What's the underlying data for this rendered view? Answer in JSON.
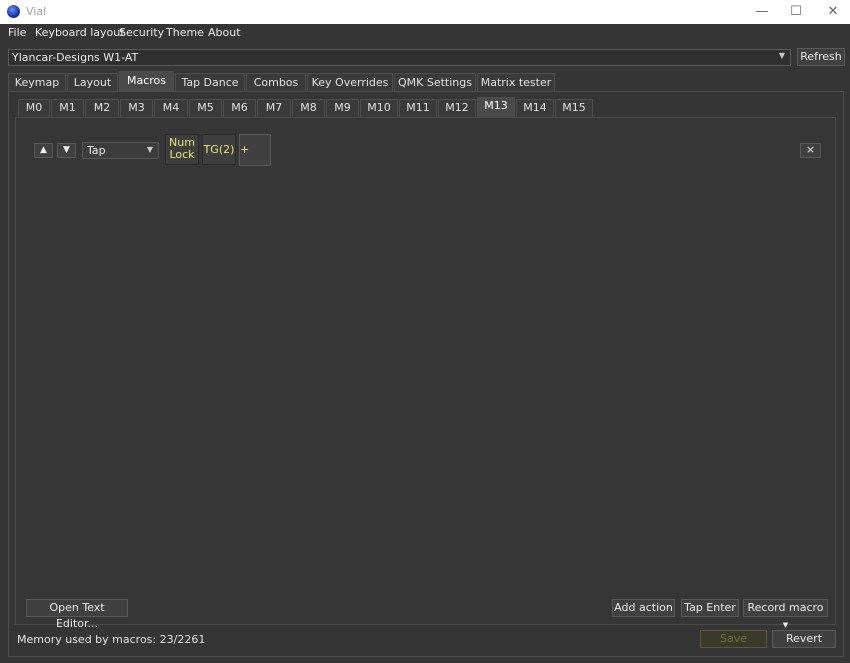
{
  "window": {
    "title": "Vial",
    "minimize_glyph": "—",
    "maximize_glyph": "☐",
    "close_glyph": "✕"
  },
  "menu": [
    "File",
    "Keyboard layout",
    "Security",
    "Theme",
    "About"
  ],
  "device": {
    "selected": "Ylancar-Designs W1-AT",
    "refresh_label": "Refresh"
  },
  "tabs": [
    "Keymap",
    "Layout",
    "Macros",
    "Tap Dance",
    "Combos",
    "Key Overrides",
    "QMK Settings",
    "Matrix tester"
  ],
  "active_tab": "Macros",
  "macro_tabs": [
    "M0",
    "M1",
    "M2",
    "M3",
    "M4",
    "M5",
    "M6",
    "M7",
    "M8",
    "M9",
    "M10",
    "M11",
    "M12",
    "M13",
    "M14",
    "M15"
  ],
  "active_macro_tab": "M13",
  "action_row": {
    "up_glyph": "▲",
    "down_glyph": "▼",
    "type_value": "Tap",
    "keys": [
      {
        "line1": "Num",
        "line2": "Lock"
      },
      {
        "label": "TG(2)"
      }
    ],
    "add_key_label": "+",
    "remove_label": "×"
  },
  "buttons": {
    "open_text_editor": "Open Text Editor...",
    "add_action": "Add action",
    "tap_enter": "Tap Enter",
    "record_macro": "Record macro",
    "save": "Save",
    "revert": "Revert"
  },
  "memory_status": "Memory used by macros: 23/2261",
  "colors": {
    "key_text": "#e6e67a",
    "save_disabled_text": "#6f6f3a",
    "background": "#353535"
  }
}
